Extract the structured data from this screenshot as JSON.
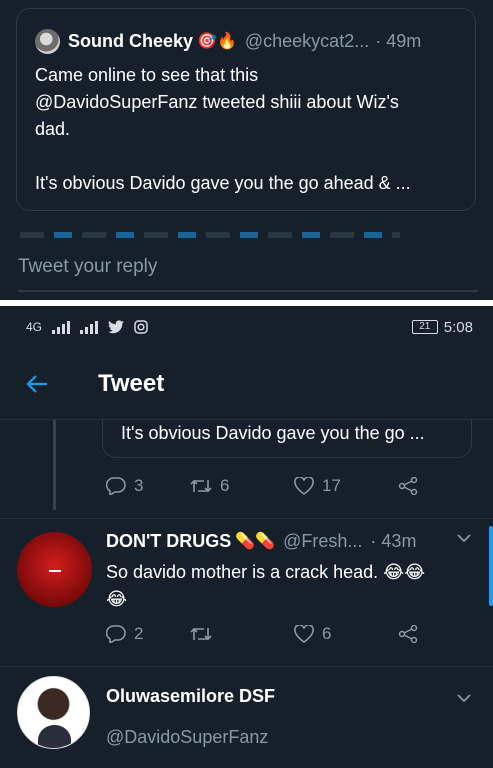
{
  "top": {
    "quoted_tweet": {
      "name": "Sound Cheeky",
      "emojis": "🎯🔥",
      "handle": "@cheekycat2...",
      "time": "· 49m",
      "lines": [
        "Came online to see that this",
        "@DavidoSuperFanz tweeted shiii about Wiz's",
        "dad.",
        "It's obvious Davido gave you the go ahead & ..."
      ]
    },
    "reply_placeholder": "Tweet your reply"
  },
  "status_bar": {
    "network": "4G",
    "time": "5:08",
    "battery": "21"
  },
  "header": {
    "title": "Tweet"
  },
  "thread": {
    "quoted_snippet": "It's obvious Davido gave you the go ...",
    "actions": {
      "replies": "3",
      "retweets": "6",
      "likes": "17"
    }
  },
  "tweet2": {
    "name": "DON'T DRUGS",
    "emojis": "💊💊",
    "handle": "@Fresh...",
    "time": "· 43m",
    "text": "So davido mother is a crack head. 😂😂",
    "text2": "😂",
    "actions": {
      "replies": "2",
      "retweets": "",
      "likes": "6"
    }
  },
  "author": {
    "name": "Oluwasemilore DSF",
    "handle": "@DavidoSuperFanz"
  },
  "colors": {
    "background": "#15202b",
    "accent": "#1d9bf0",
    "muted": "#8899a6"
  }
}
